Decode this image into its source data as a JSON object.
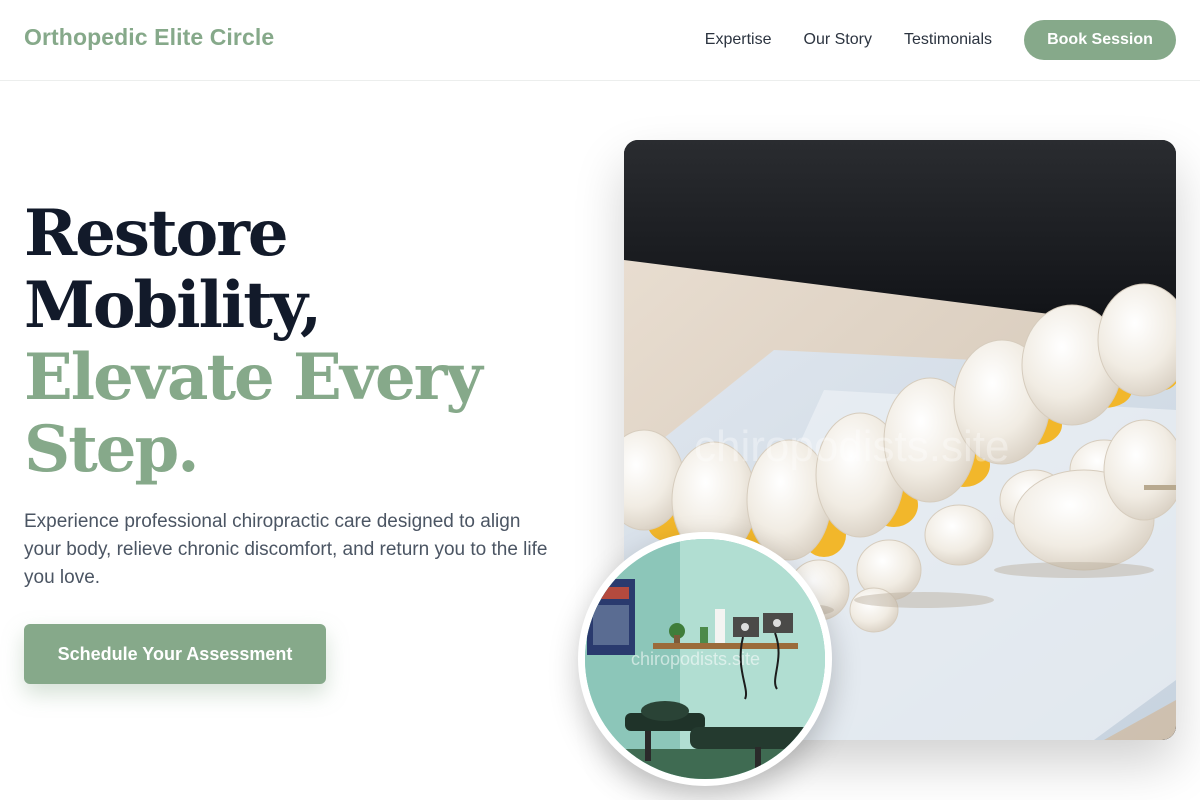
{
  "header": {
    "brand": "Orthopedic Elite Circle",
    "nav": [
      "Expertise",
      "Our Story",
      "Testimonials"
    ],
    "cta_label": "Book Session"
  },
  "hero": {
    "headline_dark_1": "Restore",
    "headline_dark_2": "Mobility,",
    "headline_green_1": "Elevate Every",
    "headline_green_2": "Step.",
    "description": "Experience professional chiropractic care designed to align your body, relieve chronic discomfort, and return you to the life you love.",
    "cta_label": "Schedule Your Assessment"
  },
  "images": {
    "main_watermark": "chiropodists.site",
    "inset_watermark": "chiropodists.site"
  },
  "colors": {
    "accent": "#86a98a",
    "headline_dark": "#121a2a",
    "body_text": "#4b5563"
  }
}
